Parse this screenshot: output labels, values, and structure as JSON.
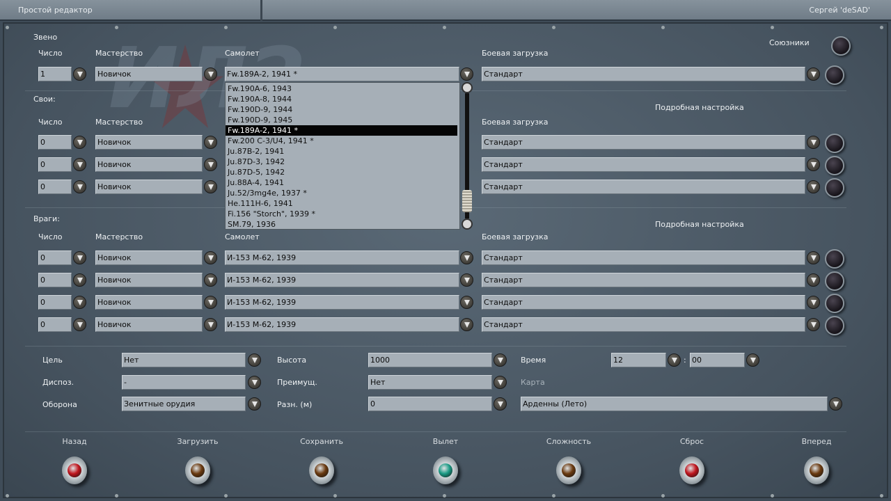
{
  "topbar": {
    "title": "Простой редактор",
    "user": "Сергей 'deSAD'"
  },
  "flight": {
    "section": "Звено",
    "col_count": "Число",
    "col_skill": "Мастерство",
    "col_plane": "Самолет",
    "col_load": "Боевая загрузка",
    "count": "1",
    "skill": "Новичок",
    "plane": "Fw.189A-2, 1941 *",
    "load": "Стандарт",
    "allies_label": "Союзники"
  },
  "plane_list": [
    "Fw.190A-6, 1943",
    "Fw.190A-8, 1944",
    "Fw.190D-9, 1944",
    "Fw.190D-9, 1945",
    "Fw.189A-2, 1941 *",
    "Fw.200 C-3/U4, 1941 *",
    "Ju.87B-2, 1941",
    "Ju.87D-3, 1942",
    "Ju.87D-5, 1942",
    "Ju.88A-4, 1941",
    "Ju.52/3mg4e, 1937 *",
    "He.111H-6, 1941",
    "Fi.156 \"Storch\", 1939 *",
    "SM.79, 1936"
  ],
  "plane_list_selected": 4,
  "friendly": {
    "section": "Свои:",
    "col_count": "Число",
    "col_skill": "Мастерство",
    "col_load": "Боевая загрузка",
    "detail": "Подробная настройка",
    "rows": [
      {
        "count": "0",
        "skill": "Новичок",
        "load": "Стандарт"
      },
      {
        "count": "0",
        "skill": "Новичок",
        "load": "Стандарт"
      },
      {
        "count": "0",
        "skill": "Новичок",
        "load": "Стандарт"
      }
    ]
  },
  "enemy": {
    "section": "Враги:",
    "col_count": "Число",
    "col_skill": "Мастерство",
    "col_plane": "Самолет",
    "col_load": "Боевая загрузка",
    "detail": "Подробная настройка",
    "rows": [
      {
        "count": "0",
        "skill": "Новичок",
        "plane": "И-153 М-62, 1939",
        "load": "Стандарт"
      },
      {
        "count": "0",
        "skill": "Новичок",
        "plane": "И-153 М-62, 1939",
        "load": "Стандарт"
      },
      {
        "count": "0",
        "skill": "Новичок",
        "plane": "И-153 М-62, 1939",
        "load": "Стандарт"
      },
      {
        "count": "0",
        "skill": "Новичок",
        "plane": "И-153 М-62, 1939",
        "load": "Стандарт"
      }
    ]
  },
  "mission": {
    "target_label": "Цель",
    "target": "Нет",
    "dispos_label": "Диспоз.",
    "dispos": "-",
    "defense_label": "Оборона",
    "defense": "Зенитные орудия",
    "altitude_label": "Высота",
    "altitude": "1000",
    "advantage_label": "Преимущ.",
    "advantage": "Нет",
    "diff_label": "Разн. (м)",
    "diff": "0",
    "time_label": "Время",
    "hour": "12",
    "colon": ":",
    "minute": "00",
    "map_label": "Карта",
    "map": "Арденны (Лето)"
  },
  "buttons": [
    {
      "label": "Назад",
      "color": "#c0161e"
    },
    {
      "label": "Загрузить",
      "color": "#6a3a10"
    },
    {
      "label": "Сохранить",
      "color": "#6a3a10"
    },
    {
      "label": "Вылет",
      "color": "#1a9a84"
    },
    {
      "label": "Сложность",
      "color": "#6a3a10"
    },
    {
      "label": "Сброс",
      "color": "#c0161e"
    },
    {
      "label": "Вперед",
      "color": "#6a3a10"
    }
  ]
}
